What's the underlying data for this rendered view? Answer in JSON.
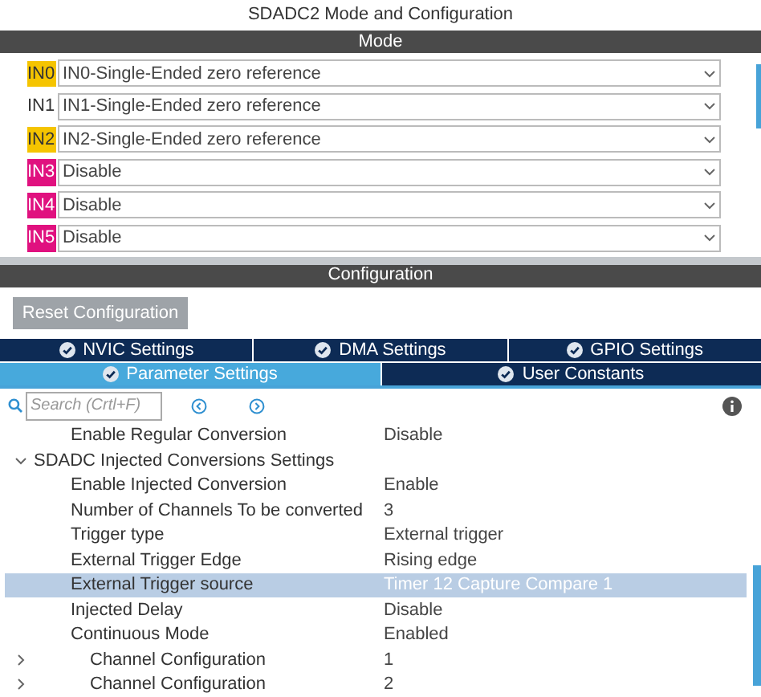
{
  "window": {
    "title": "SDADC2 Mode and Configuration"
  },
  "mode": {
    "header": "Mode",
    "channels": [
      {
        "pin": "IN0",
        "color": "#f5c400",
        "value": "IN0-Single-Ended zero reference"
      },
      {
        "pin": "IN1",
        "value": "IN1-Single-Ended zero reference"
      },
      {
        "pin": "IN2",
        "color": "#f5c400",
        "value": "IN2-Single-Ended zero reference"
      },
      {
        "pin": "IN3",
        "color": "#e0117f",
        "value": "Disable"
      },
      {
        "pin": "IN4",
        "color": "#e0117f",
        "value": "Disable"
      },
      {
        "pin": "IN5",
        "color": "#e0117f",
        "value": "Disable"
      }
    ]
  },
  "configuration": {
    "header": "Configuration",
    "reset_button": "Reset Configuration",
    "tab_rows": [
      [
        {
          "label": "NVIC Settings",
          "selected": false
        },
        {
          "label": "DMA Settings",
          "selected": false
        },
        {
          "label": "GPIO Settings",
          "selected": false
        }
      ],
      [
        {
          "label": "Parameter Settings",
          "selected": true
        },
        {
          "label": "User Constants",
          "selected": false
        }
      ]
    ],
    "search": {
      "placeholder": "Search (Crtl+F)"
    },
    "tree": [
      {
        "label": "Enable Regular Conversion",
        "value": "Disable",
        "selected": false
      },
      {
        "label": "SDADC Injected Conversions Settings",
        "expanded": true,
        "selected": false,
        "children": [
          {
            "label": "Enable Injected Conversion",
            "value": "Enable",
            "selected": false
          },
          {
            "label": "Number of Channels To be converted",
            "value": "3",
            "selected": false
          },
          {
            "label": "Trigger type",
            "value": "External trigger",
            "selected": false
          },
          {
            "label": "External Trigger Edge",
            "value": "Rising edge",
            "selected": false
          },
          {
            "label": "External Trigger source",
            "value": "Timer 12 Capture Compare 1",
            "selected": true
          },
          {
            "label": "Injected Delay",
            "value": "Disable",
            "selected": false
          },
          {
            "label": "Continuous Mode",
            "value": "Enabled",
            "selected": false
          },
          {
            "label": "Channel Configuration",
            "value": "1",
            "expanded": false,
            "selected": false
          },
          {
            "label": "Channel Configuration",
            "value": "2",
            "expanded": false,
            "selected": false
          }
        ]
      }
    ]
  }
}
